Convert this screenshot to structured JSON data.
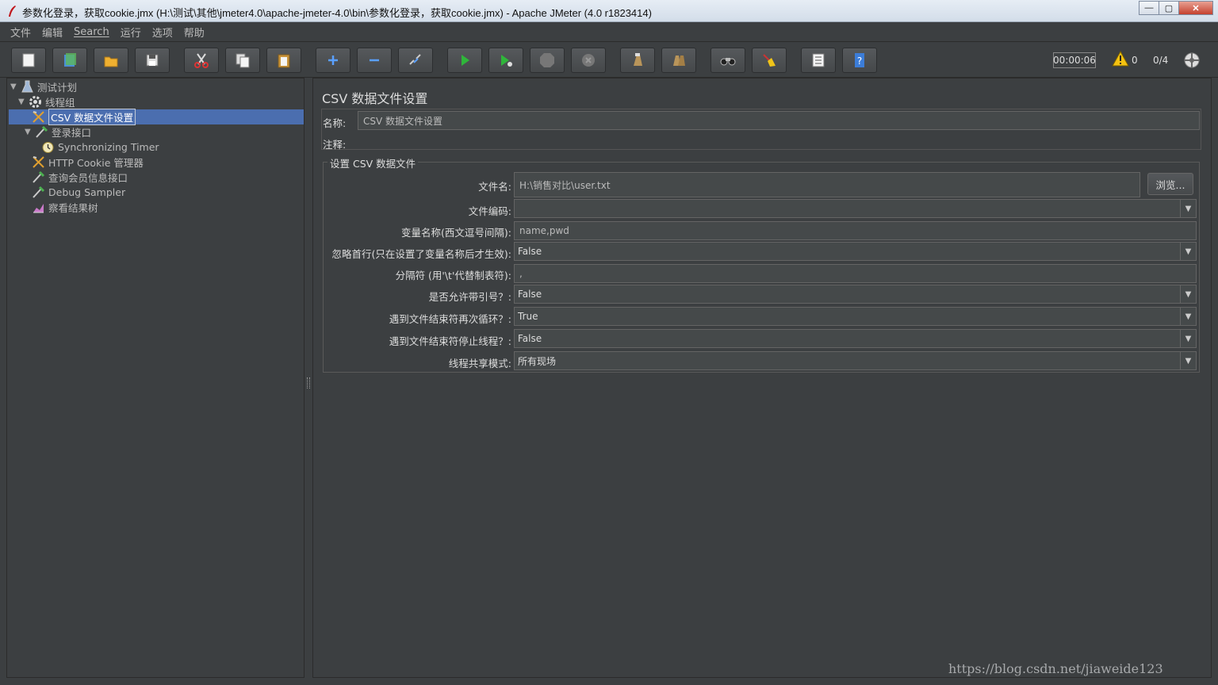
{
  "window": {
    "title": "参数化登录，获取cookie.jmx (H:\\测试\\其他\\jmeter4.0\\apache-jmeter-4.0\\bin\\参数化登录，获取cookie.jmx) - Apache JMeter (4.0 r1823414)",
    "minimize": "—",
    "maximize": "▢",
    "close": "✕"
  },
  "menu": [
    "文件",
    "编辑",
    "Search",
    "运行",
    "选项",
    "帮助"
  ],
  "toolbar": {
    "buttons": [
      {
        "name": "new-icon"
      },
      {
        "name": "templates-icon"
      },
      {
        "name": "open-icon"
      },
      {
        "name": "save-icon"
      },
      {
        "name": "cut-icon"
      },
      {
        "name": "copy-icon"
      },
      {
        "name": "paste-icon"
      },
      {
        "name": "expand-icon"
      },
      {
        "name": "collapse-icon"
      },
      {
        "name": "toggle-icon"
      },
      {
        "name": "start-icon"
      },
      {
        "name": "start-no-pause-icon"
      },
      {
        "name": "stop-icon"
      },
      {
        "name": "shutdown-icon"
      },
      {
        "name": "clear-icon"
      },
      {
        "name": "clear-all-icon"
      },
      {
        "name": "search-icon"
      },
      {
        "name": "reset-search-icon"
      },
      {
        "name": "function-helper-icon"
      },
      {
        "name": "help-icon"
      }
    ],
    "timer": "00:00:06",
    "warnings": "0",
    "threads": "0/4"
  },
  "tree": [
    {
      "label": "测试计划",
      "icon": "test-plan-icon",
      "depth": 0,
      "expander": "▼"
    },
    {
      "label": "线程组",
      "icon": "thread-group-icon",
      "depth": 1,
      "expander": "▼"
    },
    {
      "label": "CSV 数据文件设置",
      "icon": "config-element-icon",
      "depth": 2,
      "expander": "",
      "selected": true
    },
    {
      "label": "登录接口",
      "icon": "sampler-icon",
      "depth": 2,
      "expander": "▼"
    },
    {
      "label": "Synchronizing Timer",
      "icon": "timer-icon",
      "depth": 3,
      "expander": ""
    },
    {
      "label": "HTTP Cookie 管理器",
      "icon": "config-element-icon",
      "depth": 2,
      "expander": ""
    },
    {
      "label": "查询会员信息接口",
      "icon": "sampler-icon",
      "depth": 2,
      "expander": ""
    },
    {
      "label": "Debug Sampler",
      "icon": "sampler-icon",
      "depth": 2,
      "expander": ""
    },
    {
      "label": "察看结果树",
      "icon": "listener-icon",
      "depth": 2,
      "expander": ""
    }
  ],
  "panel": {
    "title": "CSV 数据文件设置",
    "name_label": "名称:",
    "name_value": "CSV 数据文件设置",
    "comment_label": "注释:",
    "comment_value": "",
    "group_title": "设置 CSV 数据文件",
    "browse": "浏览...",
    "fields": [
      {
        "label": "文件名:",
        "value": "H:\\销售对比\\user.txt",
        "kind": "text"
      },
      {
        "label": "文件编码:",
        "value": "",
        "kind": "combo"
      },
      {
        "label": "变量名称(西文逗号间隔):",
        "value": "name,pwd",
        "kind": "text"
      },
      {
        "label": "忽略首行(只在设置了变量名称后才生效):",
        "value": "False",
        "kind": "combo"
      },
      {
        "label": "分隔符 (用'\\t'代替制表符):",
        "value": ",",
        "kind": "text"
      },
      {
        "label": "是否允许带引号？:",
        "value": "False",
        "kind": "combo"
      },
      {
        "label": "遇到文件结束符再次循环？:",
        "value": "True",
        "kind": "combo"
      },
      {
        "label": "遇到文件结束符停止线程？:",
        "value": "False",
        "kind": "combo"
      },
      {
        "label": "线程共享模式:",
        "value": "所有现场",
        "kind": "combo"
      }
    ]
  },
  "watermark": "https://blog.csdn.net/jiaweide123"
}
